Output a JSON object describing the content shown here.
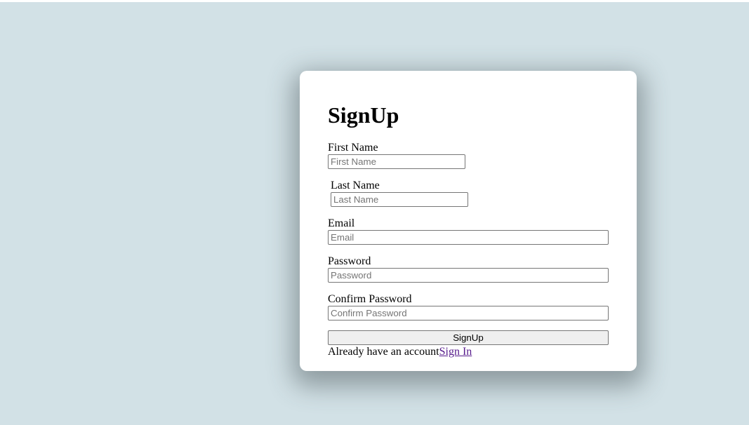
{
  "form": {
    "title": "SignUp",
    "fields": [
      {
        "label": "First Name",
        "placeholder": "First Name",
        "value": ""
      },
      {
        "label": "Last Name",
        "placeholder": "Last Name",
        "value": ""
      },
      {
        "label": "Email",
        "placeholder": "Email",
        "value": ""
      },
      {
        "label": "Password",
        "placeholder": "Password",
        "value": ""
      },
      {
        "label": "Confirm Password",
        "placeholder": "Confirm Password",
        "value": ""
      }
    ],
    "submit_label": "SignUp",
    "footer_text": "Already have an account",
    "signin_link_label": "Sign In"
  },
  "colors": {
    "background": "#d2e1e6",
    "card": "#ffffff",
    "link": "#551a8b"
  }
}
